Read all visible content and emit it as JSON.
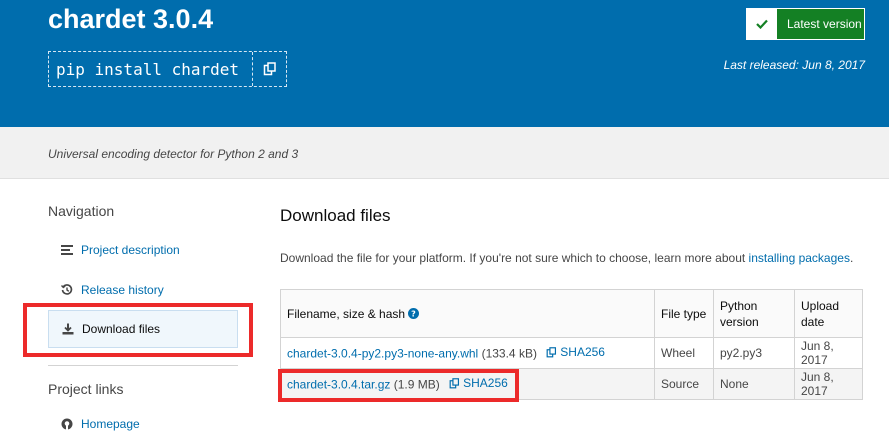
{
  "header": {
    "package_title": "chardet 3.0.4",
    "pip_command": "pip install chardet",
    "latest_button_label": "Latest version",
    "last_released": "Last released: Jun 8, 2017"
  },
  "summary": "Universal encoding detector for Python 2 and 3",
  "sidebar": {
    "navigation_heading": "Navigation",
    "items": [
      {
        "label": "Project description",
        "icon": "align-left-icon"
      },
      {
        "label": "Release history",
        "icon": "history-icon"
      },
      {
        "label": "Download files",
        "icon": "download-icon"
      }
    ],
    "project_links_heading": "Project links",
    "links": [
      {
        "label": "Homepage",
        "icon": "github-icon"
      }
    ]
  },
  "main": {
    "title": "Download files",
    "intro_text": "Download the file for your platform. If you're not sure which to choose, learn more about ",
    "intro_link": "installing packages",
    "intro_end": ".",
    "table": {
      "headers": {
        "filename": "Filename, size & hash",
        "file_type": "File type",
        "python_version": "Python version",
        "upload_date": "Upload date"
      },
      "rows": [
        {
          "filename": "chardet-3.0.4-py2.py3-none-any.whl",
          "size": "(133.4 kB)",
          "hash": "SHA256",
          "file_type": "Wheel",
          "python_version": "py2.py3",
          "upload_date": "Jun 8, 2017"
        },
        {
          "filename": "chardet-3.0.4.tar.gz",
          "size": "(1.9 MB)",
          "hash": "SHA256",
          "file_type": "Source",
          "python_version": "None",
          "upload_date": "Jun 8, 2017"
        }
      ]
    }
  },
  "colors": {
    "header_blue": "#006dad",
    "latest_green": "#148024",
    "highlight_red": "#ec2a2a"
  }
}
